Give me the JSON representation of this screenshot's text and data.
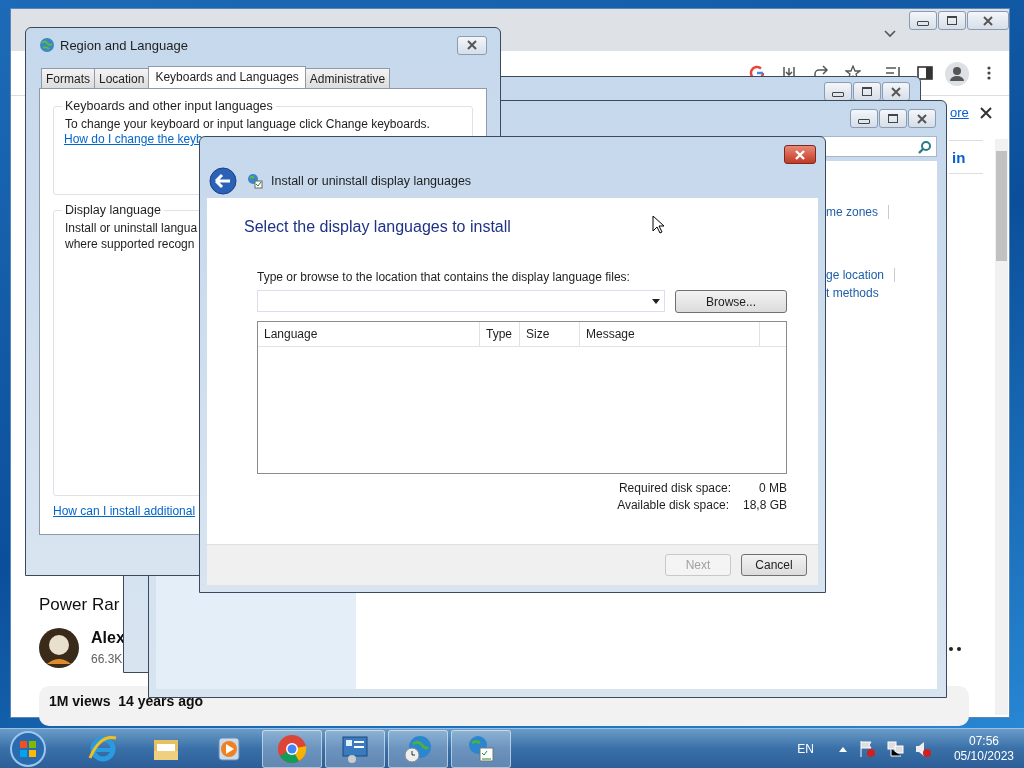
{
  "browser": {
    "banner_link": "ore",
    "sign_in": "in",
    "video_title": "Power Rar",
    "channel_name": "Alex",
    "subscribers": "66.3K",
    "stats": "1M views  14 years ago"
  },
  "control_panel": {
    "links": [
      {
        "text": "me zones",
        "divider": true
      },
      {
        "text": "ge location",
        "divider": true
      },
      {
        "text": "t methods",
        "divider": false
      }
    ]
  },
  "region_dialog": {
    "title": "Region and Language",
    "tabs": [
      {
        "label": "Formats",
        "selected": false
      },
      {
        "label": "Location",
        "selected": false
      },
      {
        "label": "Keyboards and Languages",
        "selected": true
      },
      {
        "label": "Administrative",
        "selected": false
      }
    ],
    "keyboards_group": {
      "legend": "Keyboards and other input languages",
      "text": "To change your keyboard or input language click Change keyboards.",
      "link": "How do I change the keyb"
    },
    "display_group": {
      "legend": "Display language",
      "lines": [
        "Install or uninstall langua",
        "where supported recogn"
      ]
    },
    "bottom_link": "How can I install additional"
  },
  "install_dialog": {
    "title": "Install or uninstall display languages",
    "heading": "Select the display languages to install",
    "location_label": "Type or browse to the location that contains the display language files:",
    "browse_button": "Browse...",
    "table": {
      "columns": [
        "Language",
        "Type",
        "Size",
        "Message"
      ]
    },
    "disk": [
      {
        "label": "Required disk space:",
        "value": "0 MB"
      },
      {
        "label": "Available disk space:",
        "value": "18,8 GB"
      }
    ],
    "buttons": [
      {
        "label": "Next",
        "disabled": true
      },
      {
        "label": "Cancel",
        "disabled": false
      }
    ]
  },
  "taskbar": {
    "apps": [
      {
        "kind": "ie",
        "running": false
      },
      {
        "kind": "folder",
        "running": false
      },
      {
        "kind": "media",
        "running": false
      },
      {
        "kind": "chrome",
        "running": true
      },
      {
        "kind": "control",
        "running": true
      },
      {
        "kind": "globe-clock",
        "running": true
      },
      {
        "kind": "globe-list",
        "running": true
      }
    ],
    "language": "EN",
    "time": "07:56",
    "date": "05/10/2023"
  }
}
